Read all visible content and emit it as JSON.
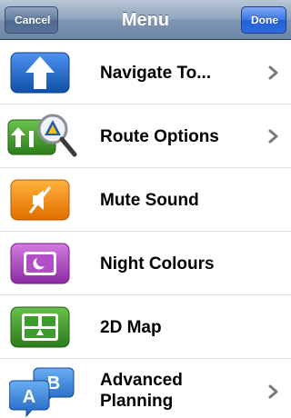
{
  "navbar": {
    "title": "Menu",
    "cancel_label": "Cancel",
    "done_label": "Done"
  },
  "menu": {
    "items": [
      {
        "label": "Navigate To...",
        "icon": "navigate-arrow-icon",
        "has_chevron": true
      },
      {
        "label": "Route Options",
        "icon": "route-options-magnifier-icon",
        "has_chevron": true
      },
      {
        "label": "Mute Sound",
        "icon": "mute-speaker-icon",
        "has_chevron": false
      },
      {
        "label": "Night Colours",
        "icon": "night-moon-icon",
        "has_chevron": false
      },
      {
        "label": "2D Map",
        "icon": "map-2d-icon",
        "has_chevron": false
      },
      {
        "label": "Advanced\nPlanning",
        "icon": "advanced-planning-ab-icon",
        "has_chevron": true
      }
    ]
  },
  "colors": {
    "navigate": "#1b63c6",
    "route": "#3f9b2a",
    "mute": "#f28a12",
    "night": "#b147c2",
    "map2d": "#3c9a2e",
    "advanced": "#2f7ed6"
  }
}
